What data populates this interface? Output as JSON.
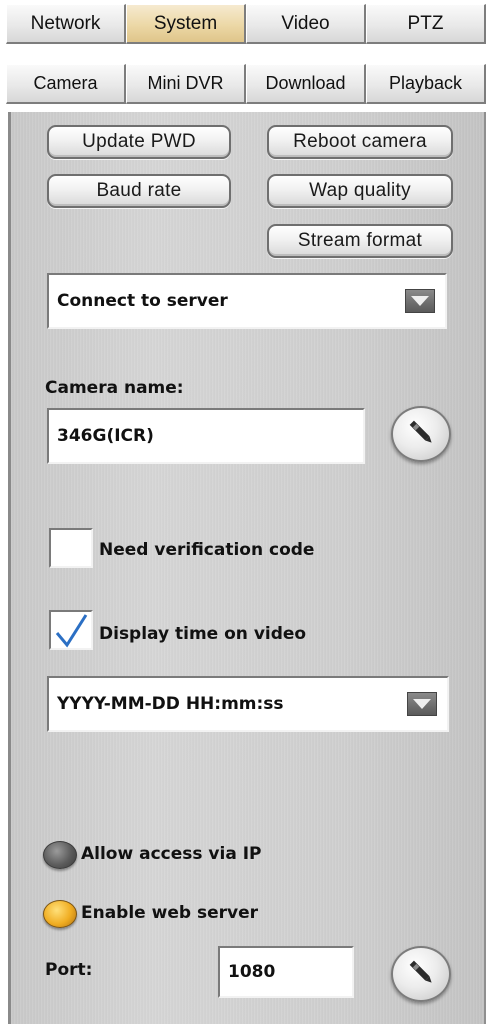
{
  "tabs_row1": [
    {
      "label": "Network",
      "active": false
    },
    {
      "label": "System",
      "active": true
    },
    {
      "label": "Video",
      "active": false
    },
    {
      "label": "PTZ",
      "active": false
    }
  ],
  "tabs_row2": [
    {
      "label": "Camera",
      "active": false
    },
    {
      "label": "Mini DVR",
      "active": false
    },
    {
      "label": "Download",
      "active": false
    },
    {
      "label": "Playback",
      "active": false
    }
  ],
  "buttons": {
    "update_pwd": "Update PWD",
    "reboot_camera": "Reboot camera",
    "baud_rate": "Baud rate",
    "wap_quality": "Wap quality",
    "stream_format": "Stream format"
  },
  "connect_dropdown": {
    "value": "Connect to server",
    "icon": "chevron-down-icon"
  },
  "camera_name": {
    "label": "Camera name:",
    "value": "346G(ICR)",
    "apply_icon": "pen-icon"
  },
  "verification": {
    "label": "Need verification code",
    "checked": false
  },
  "display_time": {
    "label": "Display time on video",
    "checked": true
  },
  "time_format_dropdown": {
    "value": "YYYY-MM-DD HH:mm:ss",
    "icon": "chevron-down-icon"
  },
  "allow_ip": {
    "label": "Allow access via IP",
    "selected": false
  },
  "web_server": {
    "label": "Enable web server",
    "selected": true
  },
  "port": {
    "label": "Port:",
    "value": "1080",
    "apply_icon": "pen-icon"
  },
  "colors": {
    "active_tab": "#ecd8a6",
    "panel": "#d0d0d0",
    "check_mark": "#2b6fc4",
    "radio_on": "#f0ad22",
    "radio_off": "#5c5c5c"
  }
}
